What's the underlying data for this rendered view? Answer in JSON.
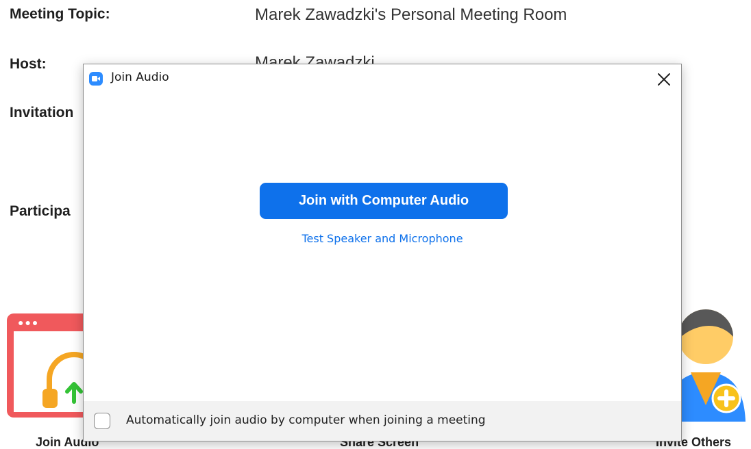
{
  "meeting_info": {
    "topic_label": "Meeting Topic:",
    "topic_value": "Marek Zawadzki's Personal Meeting Room",
    "host_label": "Host:",
    "host_value": "Marek Zawadzki",
    "invitation_label": "Invitation",
    "participant_label": "Participa"
  },
  "actions": {
    "join_audio_label": "Join Audio",
    "share_screen_label": "Share Screen",
    "invite_others_label": "Invite Others"
  },
  "dialog": {
    "title": "Join Audio",
    "join_computer_audio_label": "Join with Computer Audio",
    "test_link_label": "Test Speaker and Microphone",
    "auto_join_label": "Automatically join audio by computer when joining a meeting",
    "auto_join_checked": false
  },
  "colors": {
    "accent": "#0e71eb",
    "join_tile": "#f0595c",
    "headset": "#f5a623",
    "upload_arrow": "#34c336",
    "invite_body": "#2d8cff",
    "invite_badge": "#f8c21b"
  }
}
